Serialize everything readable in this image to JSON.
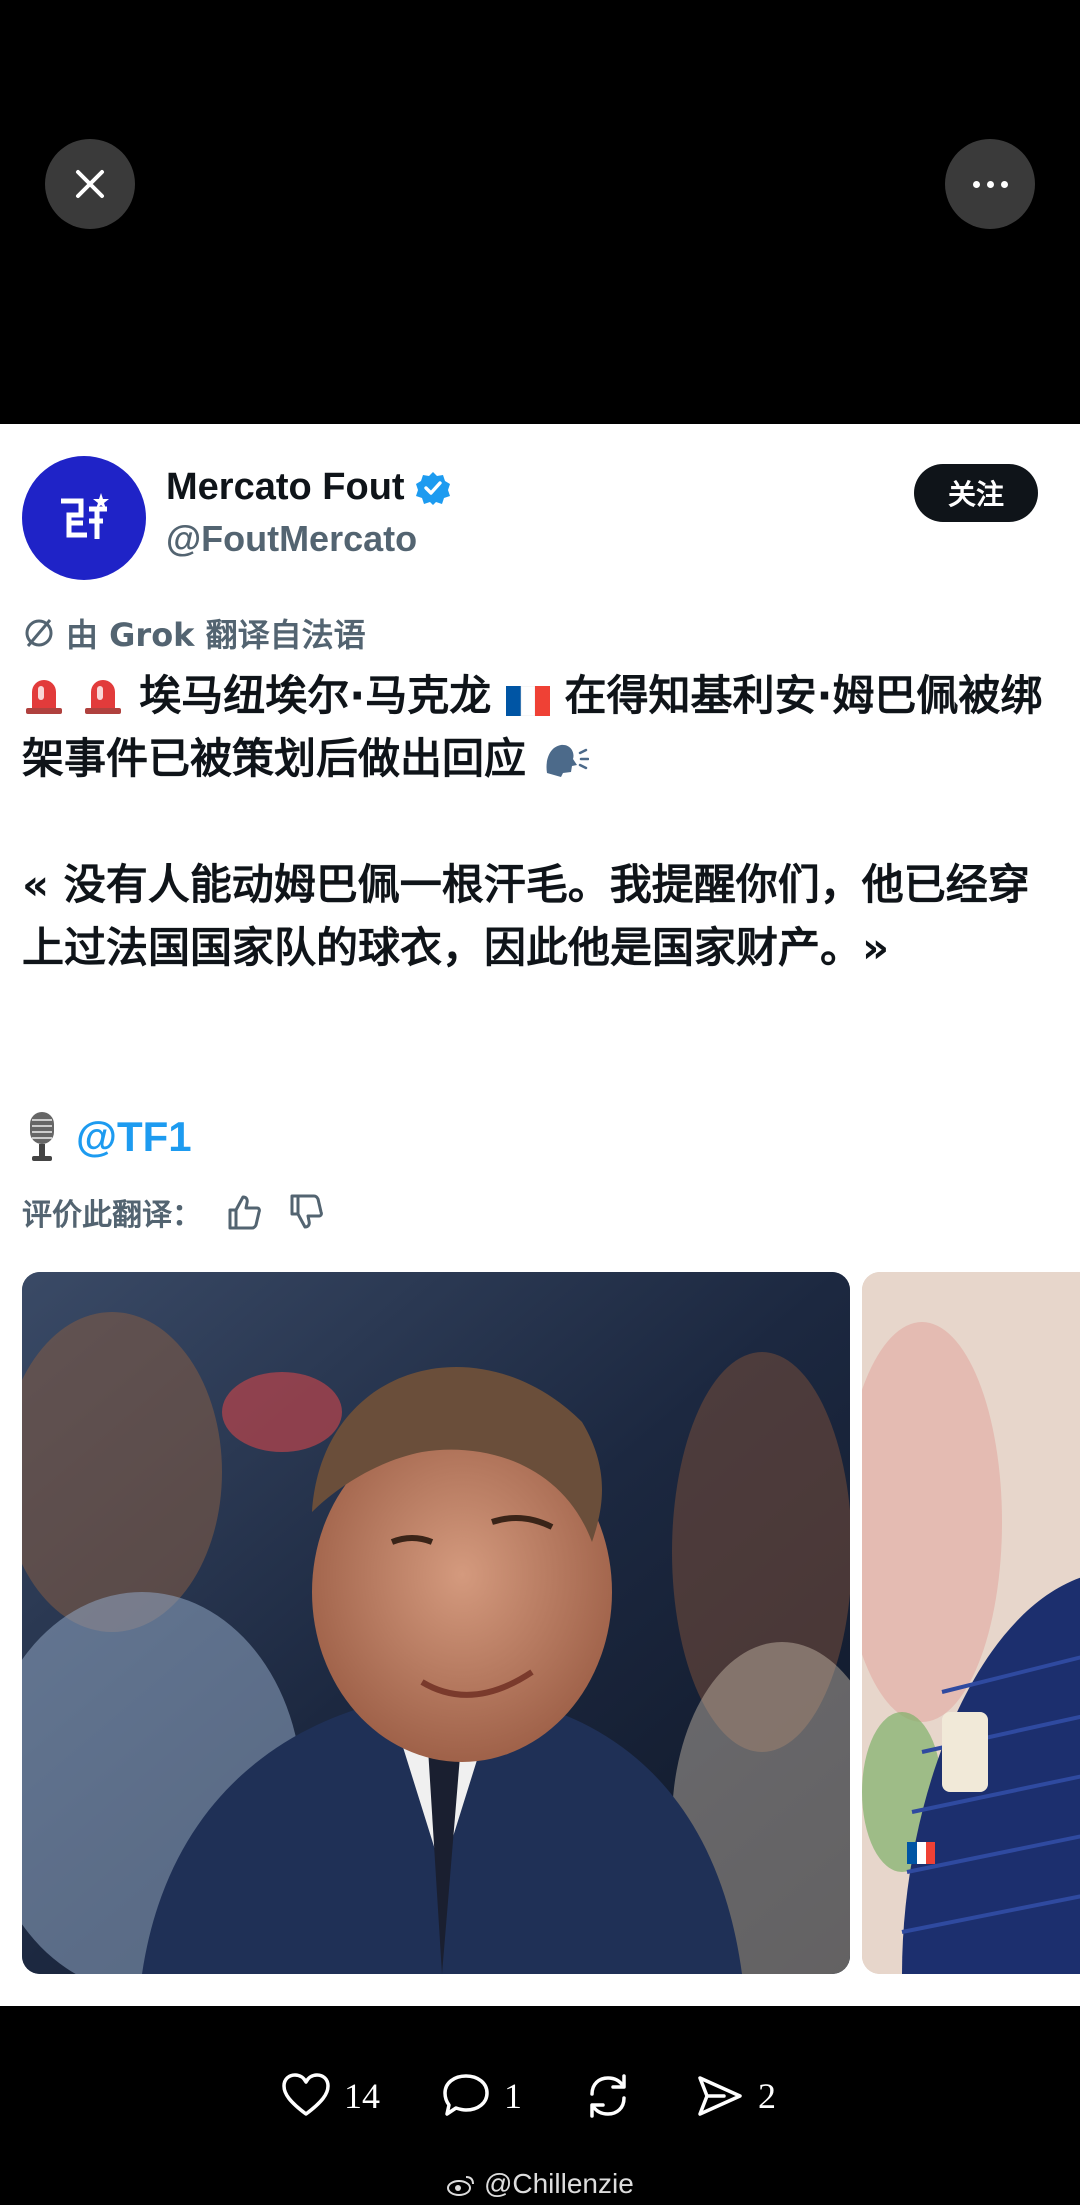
{
  "viewer": {
    "close_icon": "close-icon",
    "more_icon": "more-horizontal-icon"
  },
  "tweet": {
    "display_name": "Mercato Fout",
    "handle": "@FoutMercato",
    "follow_label": "关注",
    "translation_note": "由 Grok 翻译自法语",
    "headline": "埃马纽埃尔·马克龙",
    "headline_rest": "在得知基利安·姆巴佩被绑架事件已被策划后做出回应",
    "quote": "« 没有人能动姆巴佩一根汗毛。我提醒你们，他已经穿上过法国国家队的球衣，因此他是国家财产。»",
    "mention": "@TF1",
    "rate_label": "评价此翻译：",
    "colors": {
      "avatar": "#1f23c7",
      "verified": "#1d9bf0",
      "link": "#1d9bf0"
    }
  },
  "footer": {
    "likes": "14",
    "comments": "1",
    "shares": "2",
    "watermark": "@Chillenzie"
  }
}
